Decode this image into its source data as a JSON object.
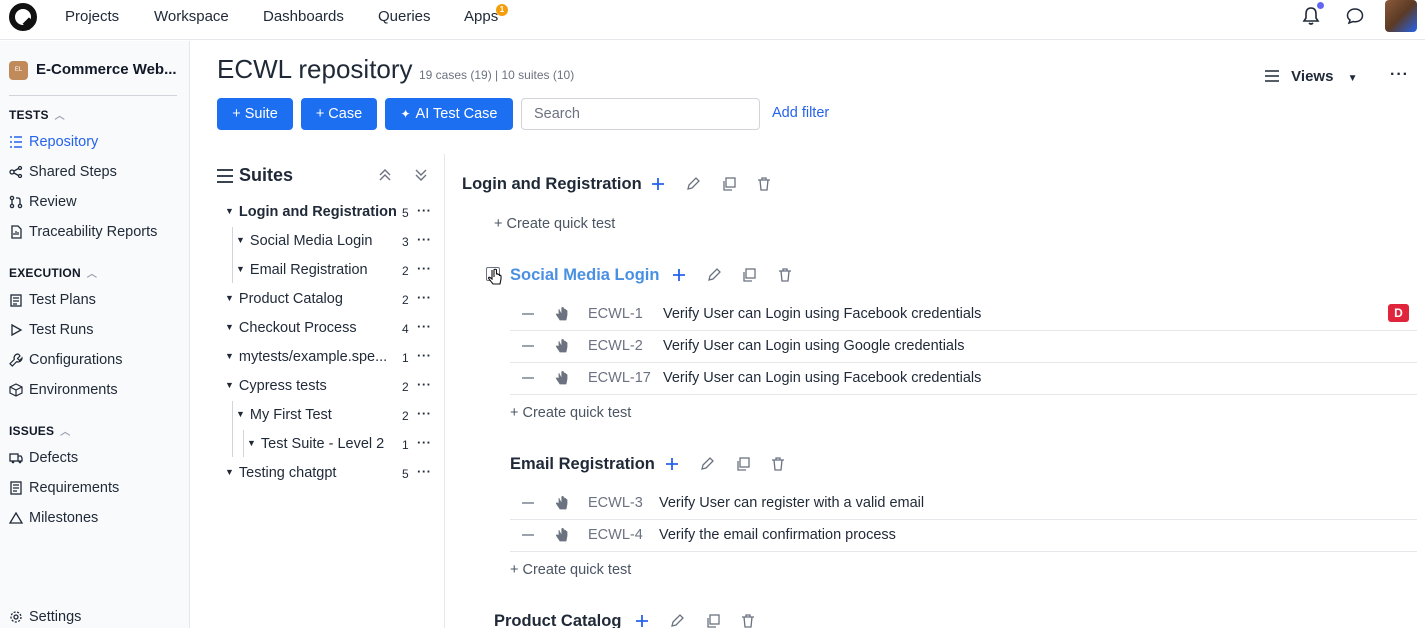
{
  "topnav": {
    "items": [
      "Projects",
      "Workspace",
      "Dashboards",
      "Queries",
      "Apps"
    ],
    "apps_badge": "1"
  },
  "sidebar": {
    "project_initials": "EL",
    "project_name": "E-Commerce Web...",
    "sections": [
      {
        "title": "TESTS",
        "items": [
          "Repository",
          "Shared Steps",
          "Review",
          "Traceability Reports"
        ]
      },
      {
        "title": "EXECUTION",
        "items": [
          "Test Plans",
          "Test Runs",
          "Configurations",
          "Environments"
        ]
      },
      {
        "title": "ISSUES",
        "items": [
          "Defects",
          "Requirements",
          "Milestones"
        ]
      }
    ],
    "settings": "Settings"
  },
  "header": {
    "title": "ECWL repository",
    "meta": "19 cases (19) | 10 suites (10)",
    "views_label": "Views"
  },
  "toolbar": {
    "suite_btn": "+ Suite",
    "case_btn": "+ Case",
    "ai_btn": "AI Test Case",
    "search_placeholder": "Search",
    "add_filter": "Add filter"
  },
  "suites": {
    "title": "Suites",
    "tree": [
      {
        "label": "Login and Registration",
        "count": "5",
        "level": 0,
        "bold": true
      },
      {
        "label": "Social Media Login",
        "count": "3",
        "level": 1
      },
      {
        "label": "Email Registration",
        "count": "2",
        "level": 1
      },
      {
        "label": "Product Catalog",
        "count": "2",
        "level": 0
      },
      {
        "label": "Checkout Process",
        "count": "4",
        "level": 0
      },
      {
        "label": "mytests/example.spe...",
        "count": "1",
        "level": 0
      },
      {
        "label": "Cypress tests",
        "count": "2",
        "level": 0
      },
      {
        "label": "My First Test",
        "count": "2",
        "level": 1
      },
      {
        "label": "Test Suite - Level 2",
        "count": "1",
        "level": 2
      },
      {
        "label": "Testing chatgpt",
        "count": "5",
        "level": 0
      }
    ]
  },
  "content": {
    "quick_test": "+ Create quick test",
    "groups": {
      "login": "Login and Registration",
      "social": "Social Media Login",
      "email": "Email Registration",
      "catalog": "Product Catalog"
    },
    "social_cases": [
      {
        "id": "ECWL-1",
        "title": "Verify User can Login using Facebook credentials",
        "badge": "D"
      },
      {
        "id": "ECWL-2",
        "title": "Verify User can Login using Google credentials"
      },
      {
        "id": "ECWL-17",
        "title": "Verify User can Login using Facebook credentials"
      }
    ],
    "email_cases": [
      {
        "id": "ECWL-3",
        "title": "Verify User can register with a valid email"
      },
      {
        "id": "ECWL-4",
        "title": "Verify the email confirmation process"
      }
    ]
  },
  "colors": {
    "accent": "#1d6ff2",
    "link": "#2563eb",
    "badge_red": "#e0243c",
    "apps_badge": "#f59e0b"
  }
}
